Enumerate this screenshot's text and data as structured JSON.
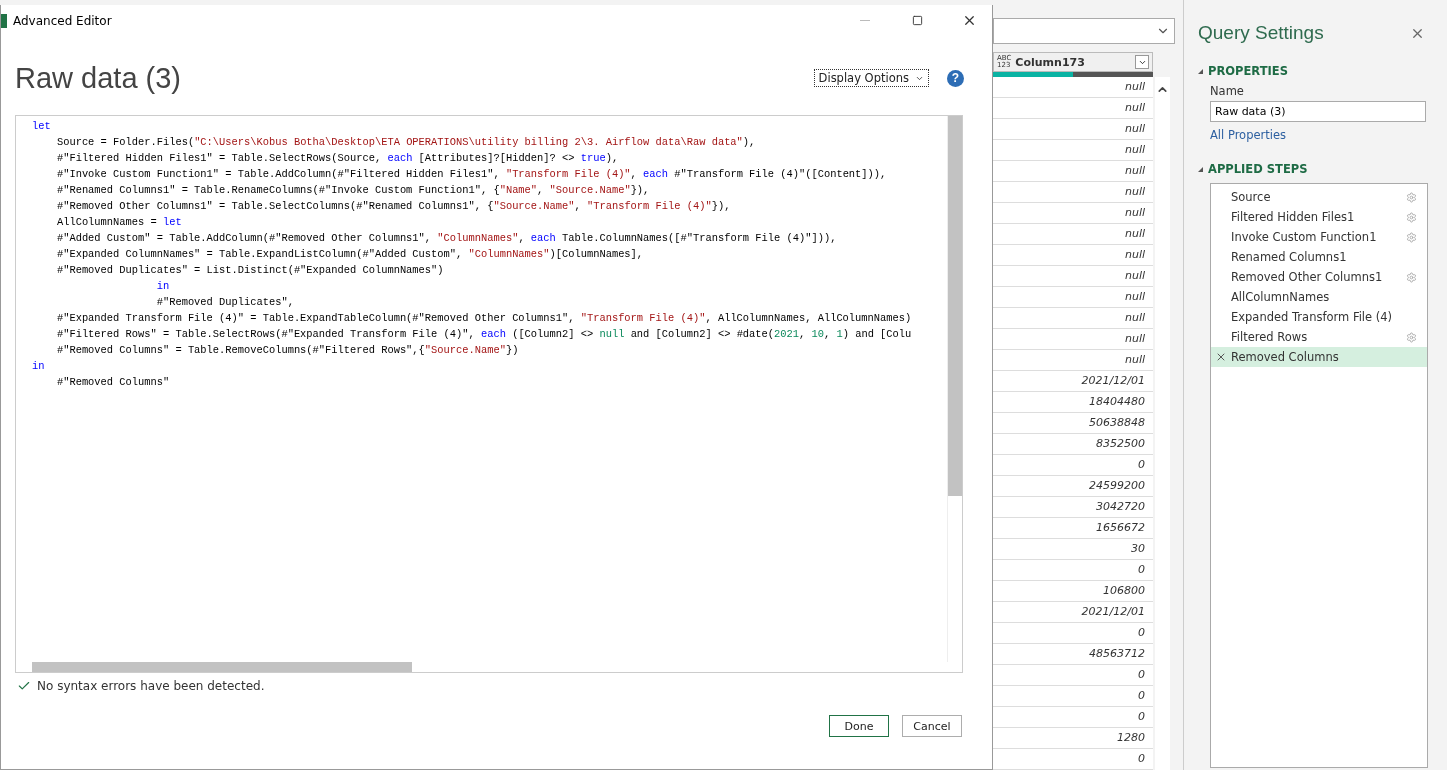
{
  "dialog": {
    "title": "Advanced Editor",
    "heading": "Raw data (3)",
    "display_options": "Display Options",
    "help": "?",
    "code_lines": [
      [
        {
          "kind": "kw",
          "t": "let"
        }
      ],
      [
        {
          "kind": "p",
          "t": "    Source = Folder.Files("
        },
        {
          "kind": "str",
          "t": "\"C:\\Users\\Kobus Botha\\Desktop\\ETA OPERATIONS\\utility billing 2\\3. Airflow data\\Raw data\""
        },
        {
          "kind": "p",
          "t": "),"
        }
      ],
      [
        {
          "kind": "p",
          "t": "    #\"Filtered Hidden Files1\" = Table.SelectRows(Source, "
        },
        {
          "kind": "kw",
          "t": "each"
        },
        {
          "kind": "p",
          "t": " [Attributes]?[Hidden]? <> "
        },
        {
          "kind": "kw",
          "t": "true"
        },
        {
          "kind": "p",
          "t": "),"
        }
      ],
      [
        {
          "kind": "p",
          "t": "    #\"Invoke Custom Function1\" = Table.AddColumn(#\"Filtered Hidden Files1\", "
        },
        {
          "kind": "str",
          "t": "\"Transform File (4)\""
        },
        {
          "kind": "p",
          "t": ", "
        },
        {
          "kind": "kw",
          "t": "each"
        },
        {
          "kind": "p",
          "t": " #\"Transform File (4)\"([Content])),"
        }
      ],
      [
        {
          "kind": "p",
          "t": "    #\"Renamed Columns1\" = Table.RenameColumns(#\"Invoke Custom Function1\", {"
        },
        {
          "kind": "str",
          "t": "\"Name\""
        },
        {
          "kind": "p",
          "t": ", "
        },
        {
          "kind": "str",
          "t": "\"Source.Name\""
        },
        {
          "kind": "p",
          "t": "}),"
        }
      ],
      [
        {
          "kind": "p",
          "t": "    #\"Removed Other Columns1\" = Table.SelectColumns(#\"Renamed Columns1\", {"
        },
        {
          "kind": "str",
          "t": "\"Source.Name\""
        },
        {
          "kind": "p",
          "t": ", "
        },
        {
          "kind": "str",
          "t": "\"Transform File (4)\""
        },
        {
          "kind": "p",
          "t": "}),"
        }
      ],
      [
        {
          "kind": "p",
          "t": "    AllColumnNames = "
        },
        {
          "kind": "kw",
          "t": "let"
        }
      ],
      [
        {
          "kind": "p",
          "t": "    #\"Added Custom\" = Table.AddColumn(#\"Removed Other Columns1\", "
        },
        {
          "kind": "str",
          "t": "\"ColumnNames\""
        },
        {
          "kind": "p",
          "t": ", "
        },
        {
          "kind": "kw",
          "t": "each"
        },
        {
          "kind": "p",
          "t": " Table.ColumnNames([#\"Transform File (4)\"])),"
        }
      ],
      [
        {
          "kind": "p",
          "t": "    #\"Expanded ColumnNames\" = Table.ExpandListColumn(#\"Added Custom\", "
        },
        {
          "kind": "str",
          "t": "\"ColumnNames\""
        },
        {
          "kind": "p",
          "t": ")[ColumnNames],"
        }
      ],
      [
        {
          "kind": "p",
          "t": "    #\"Removed Duplicates\" = List.Distinct(#\"Expanded ColumnNames\")"
        }
      ],
      [
        {
          "kind": "kw",
          "t": "                    in"
        }
      ],
      [
        {
          "kind": "p",
          "t": "                    #\"Removed Duplicates\","
        }
      ],
      [
        {
          "kind": "p",
          "t": "    #\"Expanded Transform File (4)\" = Table.ExpandTableColumn(#\"Removed Other Columns1\", "
        },
        {
          "kind": "str",
          "t": "\"Transform File (4)\""
        },
        {
          "kind": "p",
          "t": ", AllColumnNames, AllColumnNames)"
        }
      ],
      [
        {
          "kind": "p",
          "t": "    #\"Filtered Rows\" = Table.SelectRows(#\"Expanded Transform File (4)\", "
        },
        {
          "kind": "kw",
          "t": "each"
        },
        {
          "kind": "p",
          "t": " ([Column2] <> "
        },
        {
          "kind": "num",
          "t": "null"
        },
        {
          "kind": "p",
          "t": " and [Column2] <> #date("
        },
        {
          "kind": "num",
          "t": "2021"
        },
        {
          "kind": "p",
          "t": ", "
        },
        {
          "kind": "num",
          "t": "10"
        },
        {
          "kind": "p",
          "t": ", "
        },
        {
          "kind": "num",
          "t": "1"
        },
        {
          "kind": "p",
          "t": ") and [Colu"
        }
      ],
      [
        {
          "kind": "p",
          "t": "    #\"Removed Columns\" = Table.RemoveColumns(#\"Filtered Rows\",{"
        },
        {
          "kind": "str",
          "t": "\"Source.Name\""
        },
        {
          "kind": "p",
          "t": "})"
        }
      ],
      [
        {
          "kind": "kw",
          "t": "in"
        }
      ],
      [
        {
          "kind": "p",
          "t": "    #\"Removed Columns\""
        }
      ]
    ],
    "status": "No syntax errors have been detected.",
    "buttons": [
      "Done",
      "Cancel"
    ]
  },
  "grid": {
    "column": "Column173",
    "type_label": "ABC\n123",
    "values": [
      "null",
      "null",
      "null",
      "null",
      "null",
      "null",
      "null",
      "null",
      "null",
      "null",
      "null",
      "null",
      "null",
      "null",
      "2021/12/01",
      "18404480",
      "50638848",
      "8352500",
      "0",
      "24599200",
      "3042720",
      "1656672",
      "30",
      "0",
      "106800",
      "2021/12/01",
      "0",
      "48563712",
      "0",
      "0",
      "0",
      "1280",
      "0"
    ]
  },
  "query_settings": {
    "title": "Query Settings",
    "properties_label": "PROPERTIES",
    "name_label": "Name",
    "name_value": "Raw data (3)",
    "all_properties": "All Properties",
    "steps_label": "APPLIED STEPS",
    "steps": [
      {
        "label": "Source",
        "gear": true,
        "selected": false
      },
      {
        "label": "Filtered Hidden Files1",
        "gear": true,
        "selected": false
      },
      {
        "label": "Invoke Custom Function1",
        "gear": true,
        "selected": false
      },
      {
        "label": "Renamed Columns1",
        "gear": false,
        "selected": false
      },
      {
        "label": "Removed Other Columns1",
        "gear": true,
        "selected": false
      },
      {
        "label": "AllColumnNames",
        "gear": false,
        "selected": false
      },
      {
        "label": "Expanded Transform File (4)",
        "gear": false,
        "selected": false
      },
      {
        "label": "Filtered Rows",
        "gear": true,
        "selected": false
      },
      {
        "label": "Removed Columns",
        "gear": false,
        "selected": true
      }
    ]
  }
}
